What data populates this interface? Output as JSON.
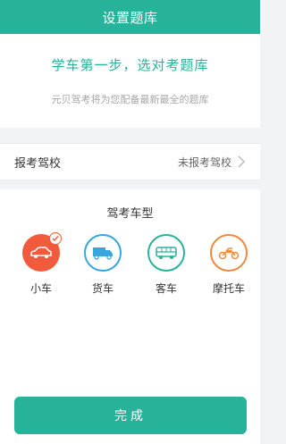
{
  "header": {
    "title": "设置题库"
  },
  "intro": {
    "headline": "学车第一步，选对考题库",
    "subtitle": "元贝驾考将为您配备最新最全的题库"
  },
  "school": {
    "label": "报考驾校",
    "value": "未报考驾校"
  },
  "vehicle_types": {
    "heading": "驾考车型",
    "selected": "小车",
    "items": [
      {
        "label": "小车",
        "icon": "car-icon",
        "color": "#f15a3a"
      },
      {
        "label": "货车",
        "icon": "truck-icon",
        "color": "#36a5e0"
      },
      {
        "label": "客车",
        "icon": "bus-icon",
        "color": "#27b39a"
      },
      {
        "label": "摩托车",
        "icon": "motorcycle-icon",
        "color": "#f08a3e"
      }
    ]
  },
  "footer": {
    "done_label": "完成"
  },
  "colors": {
    "accent": "#27b39a",
    "background": "#f2f3f5"
  }
}
